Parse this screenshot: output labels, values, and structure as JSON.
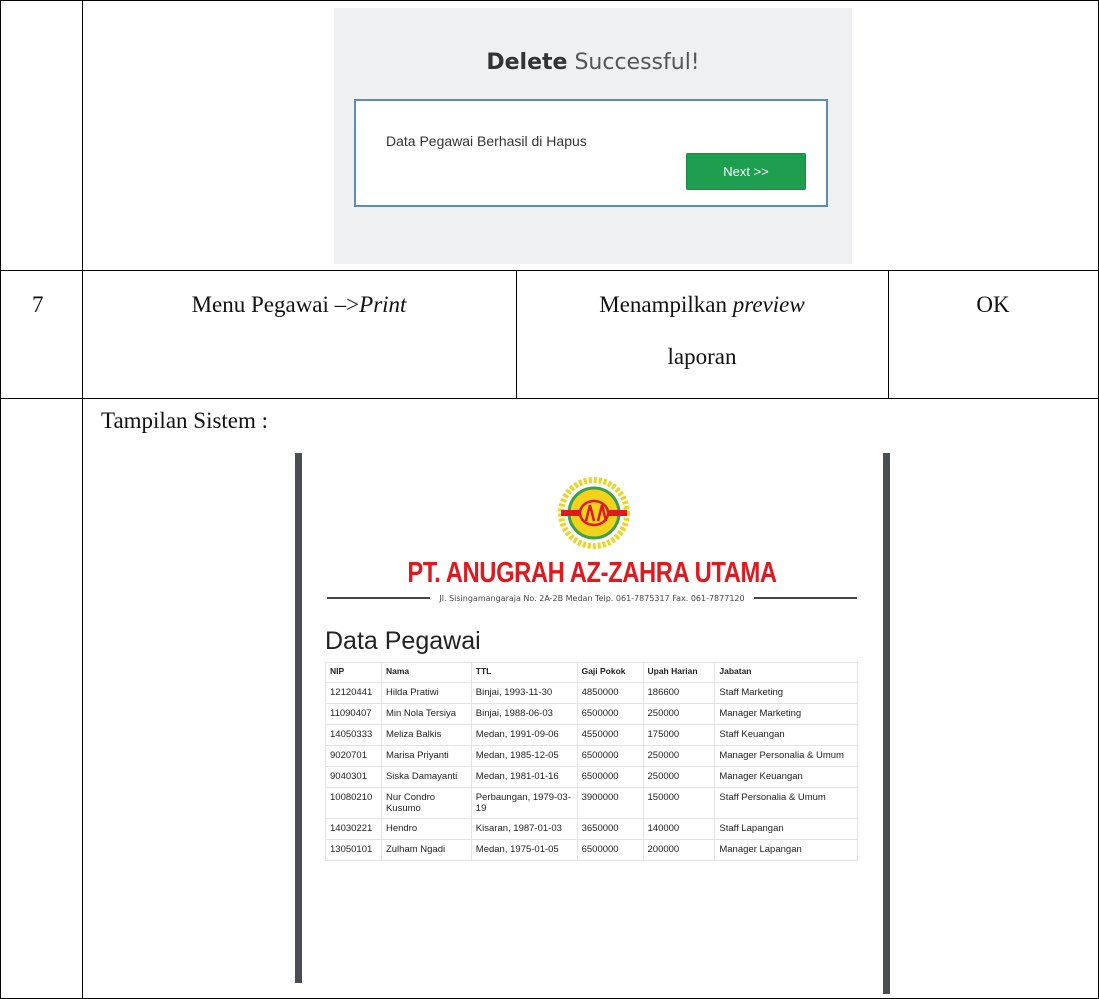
{
  "popup": {
    "title_bold": "Delete",
    "title_rest": " Successful!",
    "message": "Data Pegawai Berhasil di Hapus",
    "next_label": "Next >>"
  },
  "test_row": {
    "number": "7",
    "scenario_text": "Menu Pegawai –>",
    "scenario_italic": "Print",
    "expected_line1_text": "Menampilkan ",
    "expected_line1_italic": "preview",
    "expected_line2": "laporan",
    "result": "OK"
  },
  "system_view_label": "Tampilan Sistem :",
  "report": {
    "company": "PT. ANUGRAH AZ-ZAHRA UTAMA",
    "address": "Jl. Sisingamangaraja No. 2A-2B Medan Telp. 061-7875317 Fax. 061-7877120",
    "title": "Data Pegawai",
    "columns": [
      "NIP",
      "Nama",
      "TTL",
      "Gaji Pokok",
      "Upah Harian",
      "Jabatan"
    ],
    "rows": [
      [
        "12120441",
        "Hilda Pratiwi",
        "Binjai, 1993-11-30",
        "4850000",
        "186600",
        "Staff Marketing"
      ],
      [
        "11090407",
        "Min Nola Tersiya",
        "Binjai, 1988-06-03",
        "6500000",
        "250000",
        "Manager Marketing"
      ],
      [
        "14050333",
        "Meliza Balkis",
        "Medan, 1991-09-06",
        "4550000",
        "175000",
        "Staff Keuangan"
      ],
      [
        "9020701",
        "Marisa Priyanti",
        "Medan, 1985-12-05",
        "6500000",
        "250000",
        "Manager Personalia & Umum"
      ],
      [
        "9040301",
        "Siska Damayanti",
        "Medan, 1981-01-16",
        "6500000",
        "250000",
        "Manager Keuangan"
      ],
      [
        "10080210",
        "Nur Condro Kusumo",
        "Perbaungan, 1979-03-19",
        "3900000",
        "150000",
        "Staff Personalia & Umum"
      ],
      [
        "14030221",
        "Hendro",
        "Kisaran, 1987-01-03",
        "3650000",
        "140000",
        "Staff Lapangan"
      ],
      [
        "13050101",
        "Zulham Ngadi",
        "Medan, 1975-01-05",
        "6500000",
        "200000",
        "Manager Lapangan"
      ]
    ]
  },
  "icons": {
    "logo": "company-logo-emblem"
  },
  "colors": {
    "brand_red": "#e0191f",
    "button_green": "#1e9e4f",
    "popup_border": "#5b8db8",
    "logo_yellow": "#f2d21b",
    "logo_green": "#3aa04a"
  }
}
